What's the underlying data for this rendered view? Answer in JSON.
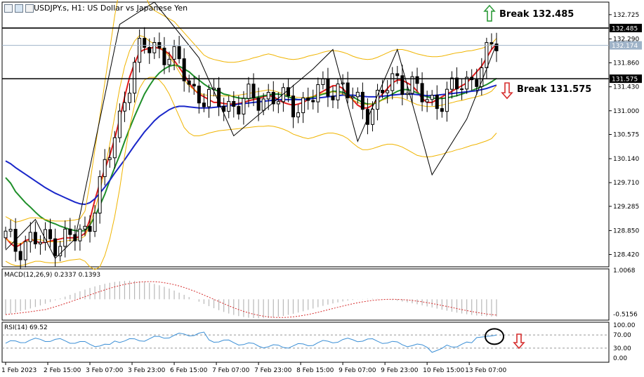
{
  "header": {
    "symbol_line": "USDJPY.s, H1:  US Dollar vs Japanese Yen"
  },
  "chart_data": {
    "type": "candlestick",
    "symbol": "USDJPY.s",
    "timeframe": "H1",
    "main_panel": {
      "y_ticks": [
        132.725,
        132.29,
        131.86,
        131.43,
        131.0,
        130.575,
        130.14,
        129.71,
        129.285,
        128.85,
        128.42
      ],
      "ylim": [
        128.2,
        132.95
      ],
      "levels": [
        {
          "name": "resistance",
          "value": 132.485,
          "label": "132.485"
        },
        {
          "name": "support",
          "value": 131.575,
          "label": "131.575"
        },
        {
          "name": "current-price",
          "value": 132.174,
          "label": "132.174"
        }
      ],
      "annotations": [
        {
          "text": "Break 132.485",
          "direction": "up",
          "color": "#2e9b3a"
        },
        {
          "text": "Break 131.575",
          "direction": "down",
          "color": "#d62d2d"
        }
      ],
      "zigzag": [
        [
          0,
          128.5
        ],
        [
          6,
          129.05
        ],
        [
          10,
          128.35
        ],
        [
          14,
          128.7
        ],
        [
          23,
          132.55
        ],
        [
          30,
          132.95
        ],
        [
          39,
          131.95
        ],
        [
          46,
          130.55
        ],
        [
          62,
          131.75
        ],
        [
          66,
          132.1
        ],
        [
          71,
          130.45
        ],
        [
          79,
          132.1
        ],
        [
          86,
          129.85
        ],
        [
          93,
          130.85
        ],
        [
          99,
          132.2
        ]
      ],
      "series": [
        {
          "name": "fast-ma",
          "color": "#e21e1e",
          "values": [
            128.72,
            128.62,
            128.55,
            128.6,
            128.67,
            128.7,
            128.66,
            128.63,
            128.64,
            128.66,
            128.68,
            128.7,
            128.72,
            128.72,
            128.72,
            128.74,
            128.8,
            129.05,
            129.4,
            129.7,
            129.95,
            130.2,
            130.5,
            130.85,
            131.25,
            131.6,
            131.85,
            132.05,
            132.1,
            132.12,
            132.14,
            132.12,
            132.08,
            132.02,
            131.9,
            131.78,
            131.65,
            131.5,
            131.38,
            131.3,
            131.25,
            131.2,
            131.15,
            131.15,
            131.13,
            131.12,
            131.12,
            131.13,
            131.15,
            131.18,
            131.2,
            131.22,
            131.25,
            131.28,
            131.25,
            131.2,
            131.15,
            131.12,
            131.1,
            131.12,
            131.15,
            131.2,
            131.25,
            131.3,
            131.35,
            131.4,
            131.45,
            131.45,
            131.4,
            131.3,
            131.2,
            131.1,
            131.05,
            131.05,
            131.1,
            131.2,
            131.3,
            131.4,
            131.5,
            131.55,
            131.55,
            131.5,
            131.45,
            131.35,
            131.22,
            131.15,
            131.15,
            131.2,
            131.25,
            131.3,
            131.35,
            131.4,
            131.45,
            131.5,
            131.6,
            131.7,
            131.8,
            131.95,
            132.1,
            132.2
          ]
        },
        {
          "name": "medium-ma",
          "color": "#1f8f2a",
          "values": [
            129.8,
            129.7,
            129.55,
            129.45,
            129.35,
            129.27,
            129.18,
            129.1,
            129.04,
            129.0,
            128.97,
            128.93,
            128.9,
            128.87,
            128.85,
            128.84,
            128.85,
            128.95,
            129.1,
            129.3,
            129.5,
            129.75,
            129.98,
            130.2,
            130.45,
            130.68,
            130.9,
            131.1,
            131.3,
            131.45,
            131.58,
            131.68,
            131.75,
            131.8,
            131.82,
            131.8,
            131.75,
            131.7,
            131.62,
            131.55,
            131.48,
            131.42,
            131.38,
            131.35,
            131.3,
            131.28,
            131.25,
            131.23,
            131.22,
            131.22,
            131.23,
            131.25,
            131.27,
            131.28,
            131.3,
            131.3,
            131.28,
            131.25,
            131.22,
            131.2,
            131.2,
            131.22,
            131.25,
            131.27,
            131.3,
            131.32,
            131.35,
            131.35,
            131.33,
            131.3,
            131.25,
            131.2,
            131.15,
            131.12,
            131.12,
            131.15,
            131.2,
            131.25,
            131.3,
            131.35,
            131.38,
            131.38,
            131.36,
            131.32,
            131.28,
            131.25,
            131.23,
            131.22,
            131.22,
            131.23,
            131.25,
            131.27,
            131.3,
            131.33,
            131.36,
            131.4,
            131.43,
            131.47,
            131.52,
            131.58
          ]
        },
        {
          "name": "slow-ma",
          "color": "#1a27c9",
          "values": [
            130.1,
            130.05,
            129.98,
            129.92,
            129.86,
            129.8,
            129.74,
            129.68,
            129.62,
            129.57,
            129.52,
            129.48,
            129.44,
            129.4,
            129.36,
            129.33,
            129.32,
            129.35,
            129.42,
            129.52,
            129.63,
            129.75,
            129.88,
            130.0,
            130.12,
            130.25,
            130.38,
            130.5,
            130.62,
            130.72,
            130.82,
            130.9,
            130.96,
            131.02,
            131.06,
            131.08,
            131.08,
            131.07,
            131.06,
            131.05,
            131.05,
            131.05,
            131.06,
            131.07,
            131.08,
            131.09,
            131.1,
            131.12,
            131.13,
            131.14,
            131.15,
            131.16,
            131.17,
            131.18,
            131.19,
            131.2,
            131.2,
            131.2,
            131.2,
            131.2,
            131.2,
            131.21,
            131.22,
            131.23,
            131.24,
            131.25,
            131.26,
            131.27,
            131.28,
            131.28,
            131.28,
            131.27,
            131.26,
            131.25,
            131.25,
            131.25,
            131.26,
            131.27,
            131.28,
            131.29,
            131.3,
            131.3,
            131.3,
            131.29,
            131.28,
            131.27,
            131.27,
            131.28,
            131.29,
            131.3,
            131.31,
            131.32,
            131.33,
            131.34,
            131.35,
            131.36,
            131.38,
            131.4,
            131.43,
            131.46
          ]
        },
        {
          "name": "bollinger-upper",
          "color": "#f0b400",
          "values": [
            129.1,
            129.05,
            129.0,
            129.02,
            129.05,
            129.08,
            129.08,
            129.07,
            129.05,
            129.03,
            129.02,
            129.02,
            129.02,
            129.03,
            129.04,
            129.06,
            129.2,
            129.7,
            130.3,
            130.9,
            131.5,
            132.1,
            132.7,
            133.2,
            133.4,
            133.45,
            133.4,
            133.3,
            133.1,
            132.9,
            132.8,
            132.75,
            132.7,
            132.65,
            132.6,
            132.5,
            132.4,
            132.3,
            132.2,
            132.1,
            132.0,
            131.95,
            131.92,
            131.9,
            131.88,
            131.87,
            131.87,
            131.88,
            131.9,
            131.92,
            131.95,
            131.97,
            132.0,
            132.02,
            132.0,
            131.97,
            131.95,
            131.93,
            131.92,
            131.93,
            131.95,
            131.98,
            132.0,
            132.02,
            132.05,
            132.07,
            132.08,
            132.07,
            132.05,
            132.02,
            131.98,
            131.95,
            131.93,
            131.92,
            131.93,
            131.96,
            132.0,
            132.04,
            132.08,
            132.1,
            132.1,
            132.08,
            132.05,
            132.02,
            132.0,
            131.98,
            131.97,
            131.97,
            131.98,
            132.0,
            132.02,
            132.04,
            132.05,
            132.07,
            132.08,
            132.1,
            132.12,
            132.15,
            132.2,
            132.3
          ]
        },
        {
          "name": "bollinger-lower",
          "color": "#f0b400",
          "values": [
            128.3,
            128.25,
            128.22,
            128.22,
            128.24,
            128.27,
            128.3,
            128.3,
            128.28,
            128.27,
            128.27,
            128.28,
            128.3,
            128.32,
            128.33,
            128.34,
            128.3,
            128.2,
            128.15,
            128.2,
            128.4,
            128.7,
            129.1,
            129.6,
            130.2,
            130.7,
            131.1,
            131.4,
            131.55,
            131.6,
            131.6,
            131.55,
            131.45,
            131.3,
            131.1,
            130.9,
            130.7,
            130.6,
            130.55,
            130.55,
            130.57,
            130.6,
            130.62,
            130.64,
            130.65,
            130.66,
            130.67,
            130.68,
            130.69,
            130.7,
            130.71,
            130.72,
            130.72,
            130.73,
            130.72,
            130.7,
            130.67,
            130.63,
            130.58,
            130.55,
            130.52,
            130.5,
            130.52,
            130.55,
            130.58,
            130.6,
            130.6,
            130.58,
            130.55,
            130.5,
            130.42,
            130.35,
            130.3,
            130.3,
            130.32,
            130.35,
            130.38,
            130.4,
            130.4,
            130.38,
            130.35,
            130.3,
            130.25,
            130.2,
            130.18,
            130.17,
            130.18,
            130.2,
            130.22,
            130.25,
            130.27,
            130.3,
            130.32,
            130.35,
            130.38,
            130.4,
            130.43,
            130.46,
            130.5,
            130.6
          ]
        }
      ]
    },
    "macd_panel": {
      "label": "MACD(12,26,9) 0.2337 0.1393",
      "y_ticks": [
        1.0068,
        -0.5156
      ],
      "ylim": [
        -0.72,
        1.05
      ]
    },
    "rsi_panel": {
      "label": "RSI(14) 69.52",
      "y_ticks": [
        100,
        70,
        30,
        0
      ],
      "y_tick_labels": [
        "100.00",
        "70.00",
        "30.00",
        "0.00"
      ],
      "levels": [
        70,
        30
      ],
      "current_value": 69.52,
      "marker_arrow_color": "#d62d2d"
    },
    "x_ticks": [
      {
        "label": "1 Feb 2023",
        "index": 0
      },
      {
        "label": "2 Feb 15:00",
        "index": 8.5
      },
      {
        "label": "3 Feb 07:00",
        "index": 17
      },
      {
        "label": "3 Feb 23:00",
        "index": 25.5
      },
      {
        "label": "6 Feb 15:00",
        "index": 34
      },
      {
        "label": "7 Feb 07:00",
        "index": 42.5
      },
      {
        "label": "7 Feb 23:00",
        "index": 51
      },
      {
        "label": "8 Feb 15:00",
        "index": 59.5
      },
      {
        "label": "9 Feb 07:00",
        "index": 68
      },
      {
        "label": "9 Feb 23:00",
        "index": 76.5
      },
      {
        "label": "10 Feb 15:00",
        "index": 85
      },
      {
        "label": "13 Feb 07:00",
        "index": 93.5
      }
    ]
  }
}
